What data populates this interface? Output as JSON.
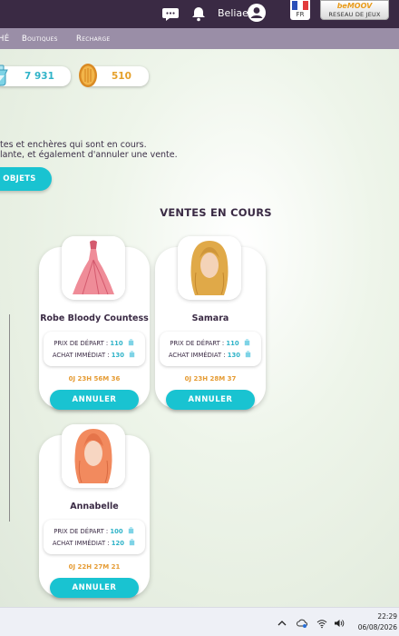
{
  "header": {
    "username": "Beliae",
    "language": "FR",
    "network_logo": "beMOOV",
    "network_label": "RESEAU DE JEUX",
    "icons": [
      "chat-icon",
      "bell-icon",
      "user-avatar-icon",
      "french-flag-icon"
    ]
  },
  "nav": {
    "items": [
      "HÉ",
      "Boutiques",
      "Recharge"
    ]
  },
  "currency": {
    "diamonds": "7 931",
    "coins": "510"
  },
  "info": {
    "line1": "tes et enchères qui sont en cours.",
    "line2": "lante, et également d'annuler une vente.",
    "objets_button": "OBJETS"
  },
  "section_title": "VENTES EN COURS",
  "sales": [
    {
      "name": "Robe Bloody Countess",
      "start_label": "PRIX DE DÉPART :",
      "start_price": "110",
      "buy_label": "ACHAT IMMÉDIAT :",
      "buy_price": "130",
      "timer": "0J 23H 56M 36",
      "cancel": "ANNULER",
      "icon": "red-dress-icon"
    },
    {
      "name": "Samara",
      "start_label": "PRIX DE DÉPART :",
      "start_price": "110",
      "buy_label": "ACHAT IMMÉDIAT :",
      "buy_price": "130",
      "timer": "0J 23H 28M 37",
      "cancel": "ANNULER",
      "icon": "blonde-hair-icon"
    },
    {
      "name": "Annabelle",
      "start_label": "PRIX DE DÉPART :",
      "start_price": "100",
      "buy_label": "ACHAT IMMÉDIAT :",
      "buy_price": "120",
      "timer": "0J 22H 27M 21",
      "cancel": "ANNULER",
      "icon": "red-hair-icon"
    }
  ],
  "taskbar": {
    "time": "22:29",
    "date": "06/08/2026"
  },
  "colors": {
    "accent": "#19c3d1",
    "topbar": "#3a2a44",
    "subnav": "#9a8ea7",
    "timer": "#e59b33"
  }
}
